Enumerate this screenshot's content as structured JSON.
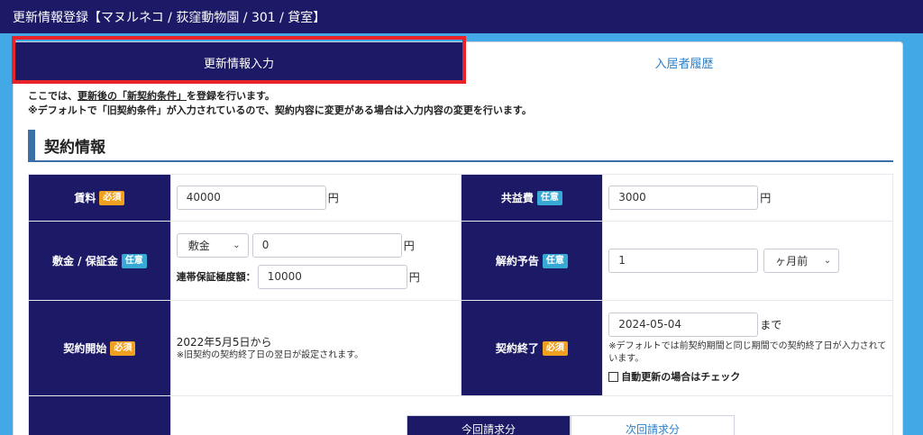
{
  "header": {
    "title": "更新情報登録【マヌルネコ / 荻窪動物園 / 301 / 貸室】"
  },
  "tabs": [
    {
      "label": "更新情報入力",
      "active": true
    },
    {
      "label": "入居者履歴",
      "active": false
    }
  ],
  "notes": {
    "line1_prefix": "ここでは、",
    "line1_underline": "更新後の「新契約条件」",
    "line1_suffix": "を登録を行います。",
    "line2": "※デフォルトで「旧契約条件」が入力されているので、契約内容に変更がある場合は入力内容の変更を行います。"
  },
  "section": {
    "title": "契約情報"
  },
  "badges": {
    "required": "必須",
    "optional": "任意"
  },
  "fields": {
    "rent": {
      "label": "賃料",
      "value": "40000",
      "unit": "円"
    },
    "common_fee": {
      "label": "共益費",
      "value": "3000",
      "unit": "円"
    },
    "deposit": {
      "label": "敷金 / 保証金",
      "type_selected": "敷金",
      "value": "0",
      "unit": "円",
      "guarantee_label": "連帯保証極度額：",
      "guarantee_value": "10000",
      "guarantee_unit": "円"
    },
    "cancel_notice": {
      "label": "解約予告",
      "value": "1",
      "unit_selected": "ヶ月前"
    },
    "contract_start": {
      "label": "契約開始",
      "value": "2022年5月5日から",
      "note": "※旧契約の契約終了日の翌日が設定されます。"
    },
    "contract_end": {
      "label": "契約終了",
      "value": "2024-05-04",
      "suffix": "まで",
      "note": "※デフォルトでは前契約期間と同じ期間での契約終了日が入力されています。",
      "auto_renew_label": "自動更新の場合はチェック"
    }
  },
  "billing_tabs": [
    {
      "label": "今回請求分",
      "active": true
    },
    {
      "label": "次回請求分",
      "active": false
    }
  ],
  "colors": {
    "navy": "#1c1a66",
    "bg": "#42a9e6",
    "required": "#f0a020",
    "optional": "#38a9d4",
    "highlight": "#e8232a"
  }
}
